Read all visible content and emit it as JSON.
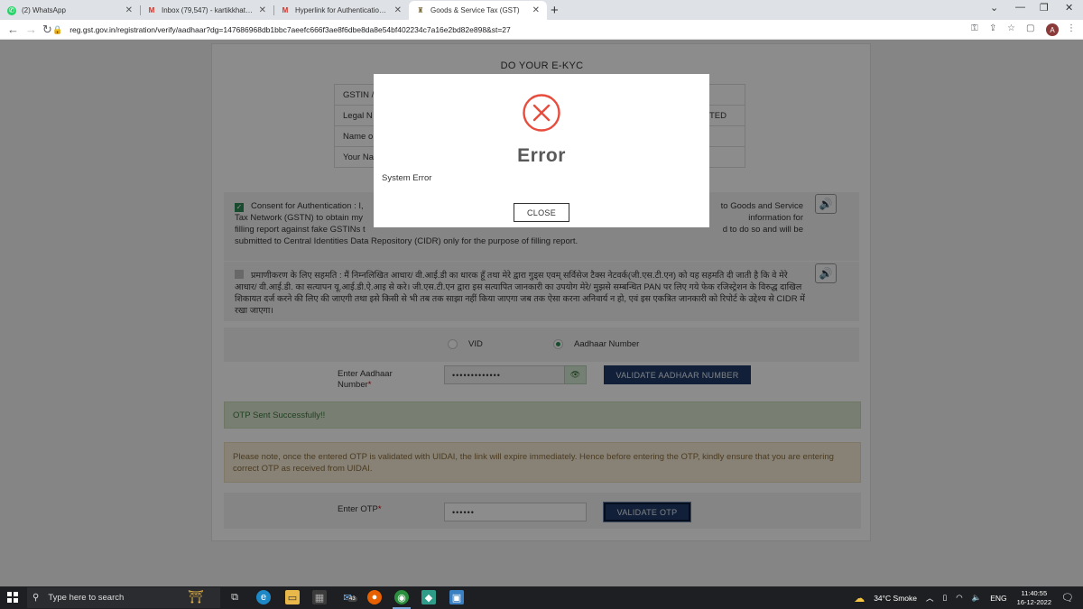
{
  "browser": {
    "tabs": [
      {
        "title": "(2) WhatsApp",
        "icon": "whatsapp-icon",
        "active": false
      },
      {
        "title": "Inbox (79,547) - kartikkhatiwala@...",
        "icon": "gmail-icon",
        "active": false
      },
      {
        "title": "Hyperlink for Authentication of ...",
        "icon": "gmail-icon",
        "active": false
      },
      {
        "title": "Goods & Service Tax (GST)",
        "icon": "gst-emblem-icon",
        "active": true
      }
    ],
    "url": "reg.gst.gov.in/registration/verify/aadhaar?dg=147686968db1bbc7aeefc666f3ae8f6dbe8da8e54bf402234c7a16e2bd82e898&st=27",
    "profile_initial": "A"
  },
  "page": {
    "title": "DO YOUR E-KYC",
    "info_rows": [
      {
        "label": "GSTIN /",
        "value": ""
      },
      {
        "label": "Legal N",
        "value": "TED"
      },
      {
        "label": "Name o",
        "value": ""
      },
      {
        "label": "Your Na",
        "value": ""
      }
    ],
    "consent_en": {
      "left_line1": "Consent for Authentication : I,",
      "right_line1": "to Goods and Service",
      "left_line2": "Tax Network (GSTN) to obtain my",
      "right_line2": "information for",
      "left_line3": "filling report against fake GSTINs t",
      "right_line3": "d to do so and will be",
      "line4": "submitted to Central Identities Data Repository (CIDR) only for the purpose of filling report."
    },
    "consent_hi": "प्रमाणीकरण के लिए सहमति : मैं निम्नलिखित आधार/ वी.आई.डी का धारक हूँ तथा मेरे द्वारा गुड्स एवम् सर्विसेज टैक्स नेटवर्क(जी.एस.टी.एन) को यह सहमति दी जाती है कि वे मेरे आधार/ वी.आई.डी. का सत्यापन यू.आई.डी.ऐ.आइ से करे। जी.एस.टी.एन द्वारा इस सत्यापित जानकारी का उपयोग मेरे/ मुझसे सम्बन्धित PAN पर लिए गये फेक रजिस्ट्रेशन के विरुद्ध दाखिल शिकायत दर्ज करने की लिए की जाएगी तथा इसे किसी से भी तब तक साझा नहीं किया जाएगा जब तक ऐसा करना अनिवार्य न हो, एवं इस एकत्रित जानकारी को रिपोर्ट के उद्देश्य से CIDR में रखा जाएगा।",
    "radio_vid": "VID",
    "radio_aadhaar": "Aadhaar Number",
    "aadhaar_label": "Enter Aadhaar Number",
    "aadhaar_value": "•••••••••••••",
    "validate_aadhaar_label": "VALIDATE AADHAAR NUMBER",
    "otp_success": "OTP Sent Successfully!!",
    "uidai_note": "Please note, once the entered OTP is validated with UIDAI, the link will expire immediately. Hence before entering the OTP, kindly ensure that you are entering correct OTP as received from UIDAI.",
    "otp_label": "Enter OTP",
    "otp_value": "••••••",
    "validate_otp_label": "VALIDATE OTP",
    "required_mark": "*"
  },
  "modal": {
    "heading": "Error",
    "message": "System Error",
    "close_label": "CLOSE",
    "icon": "error-circle-x-icon",
    "icon_color": "#e74c3c"
  },
  "taskbar": {
    "search_placeholder": "Type here to search",
    "mail_badge": "43",
    "weather": "34°C  Smoke",
    "language": "ENG",
    "time": "11:40:55",
    "date": "16-12-2022"
  },
  "colors": {
    "primary_button": "#1f3b66",
    "success_bg": "#dbe8cf",
    "warning_bg": "#f7ecd7",
    "checkbox_green": "#2e8b57"
  }
}
